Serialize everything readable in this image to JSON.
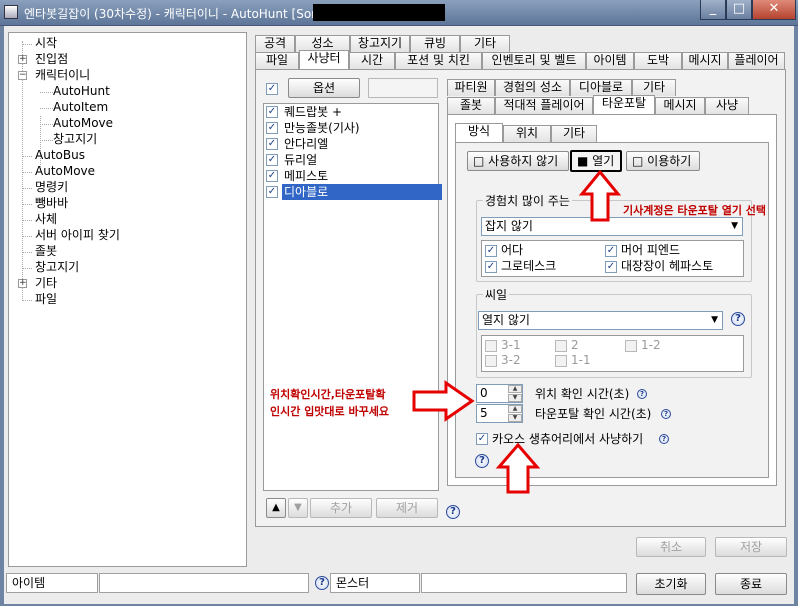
{
  "window": {
    "title": "엔타봇길잡이 (30차수정) - 캐릭터이니 - AutoHunt [Sorceress",
    "minimize": "_",
    "maximize": "□",
    "close": "✕"
  },
  "tree": {
    "items": [
      {
        "label": "시작"
      },
      {
        "label": "진입점"
      },
      {
        "label": "캐릭터이니"
      },
      {
        "label": "AutoHunt"
      },
      {
        "label": "AutoItem"
      },
      {
        "label": "AutoMove"
      },
      {
        "label": "창고지기"
      },
      {
        "label": "AutoBus"
      },
      {
        "label": "AutoMove"
      },
      {
        "label": "명령키"
      },
      {
        "label": "뺑바바"
      },
      {
        "label": "사체"
      },
      {
        "label": "서버 아이피 찾기"
      },
      {
        "label": "졸봇"
      },
      {
        "label": "창고지기"
      },
      {
        "label": "기타"
      },
      {
        "label": "파일"
      }
    ]
  },
  "top_tabs_row1": [
    "공격",
    "성소",
    "창고지기",
    "큐빙",
    "기타"
  ],
  "top_tabs_row2": [
    "파일",
    "사냥터",
    "시간",
    "포션 및 치킨",
    "인벤토리 및 벨트",
    "아이템",
    "도박",
    "메시지",
    "플레이어"
  ],
  "left_panel": {
    "options_button": "옵션",
    "list": [
      {
        "label": "퀘드랍봇 +",
        "checked": true
      },
      {
        "label": "만능졸봇(기사)",
        "checked": true
      },
      {
        "label": "안다리엘",
        "checked": true
      },
      {
        "label": "듀리얼",
        "checked": true
      },
      {
        "label": "메피스토",
        "checked": true
      },
      {
        "label": "디아블로",
        "checked": true,
        "selected": true
      }
    ],
    "up_arrow": "▲",
    "down_arrow": "▼",
    "add_button": "추가",
    "remove_button": "제거"
  },
  "sub_tabs_row1": [
    "파티원",
    "경험의 성소",
    "디아블로",
    "기타"
  ],
  "sub_tabs_row2": [
    "졸봇",
    "적대적 플레이어",
    "타운포탈",
    "메시지",
    "사냥"
  ],
  "inner_tabs": [
    "방식",
    "위치",
    "기타"
  ],
  "mode_buttons": [
    {
      "label": "사용하지 않기",
      "mark": "□"
    },
    {
      "label": "열기",
      "mark": "■"
    },
    {
      "label": "이용하기",
      "mark": "□"
    }
  ],
  "exp_group": {
    "title": "경험치 많이 주는",
    "combo_value": "잡지 않기",
    "options": [
      {
        "label": "어다",
        "checked": true
      },
      {
        "label": "머어 피엔드",
        "checked": true
      },
      {
        "label": "그로테스크",
        "checked": true
      },
      {
        "label": "대장장이 헤파스토",
        "checked": true
      }
    ]
  },
  "seal_group": {
    "title": "씨일",
    "combo_value": "열지 않기",
    "options": [
      "3-1",
      "2",
      "1-2",
      "3-2",
      "1-1"
    ]
  },
  "spinners": [
    {
      "value": "0",
      "label": "위치 확인 시간(초)"
    },
    {
      "value": "5",
      "label": "타운포탈 확인 시간(초)"
    }
  ],
  "chaos_checkbox": {
    "label": "카오스 생츄어리에서 사냥하기",
    "checked": true
  },
  "annotations": {
    "right": "기사계정은 타운포탈 열기 선택",
    "left_line1": "위치확인시간,타운포탈확",
    "left_line2": "인시간 입맛대로 바꾸세요"
  },
  "bottom_buttons": {
    "cancel": "취소",
    "save": "저장",
    "reset": "초기화",
    "close": "종료"
  },
  "status_bar": {
    "item_label": "아이템",
    "monster_label": "몬스터"
  },
  "icons": {
    "help": "?",
    "check": "✓",
    "combo_arrow": "▼",
    "spin_up": "▲",
    "spin_down": "▼"
  },
  "colors": {
    "annotation": "#c00000",
    "selection": "#3166c6",
    "titlebar": "#6e84a2"
  }
}
